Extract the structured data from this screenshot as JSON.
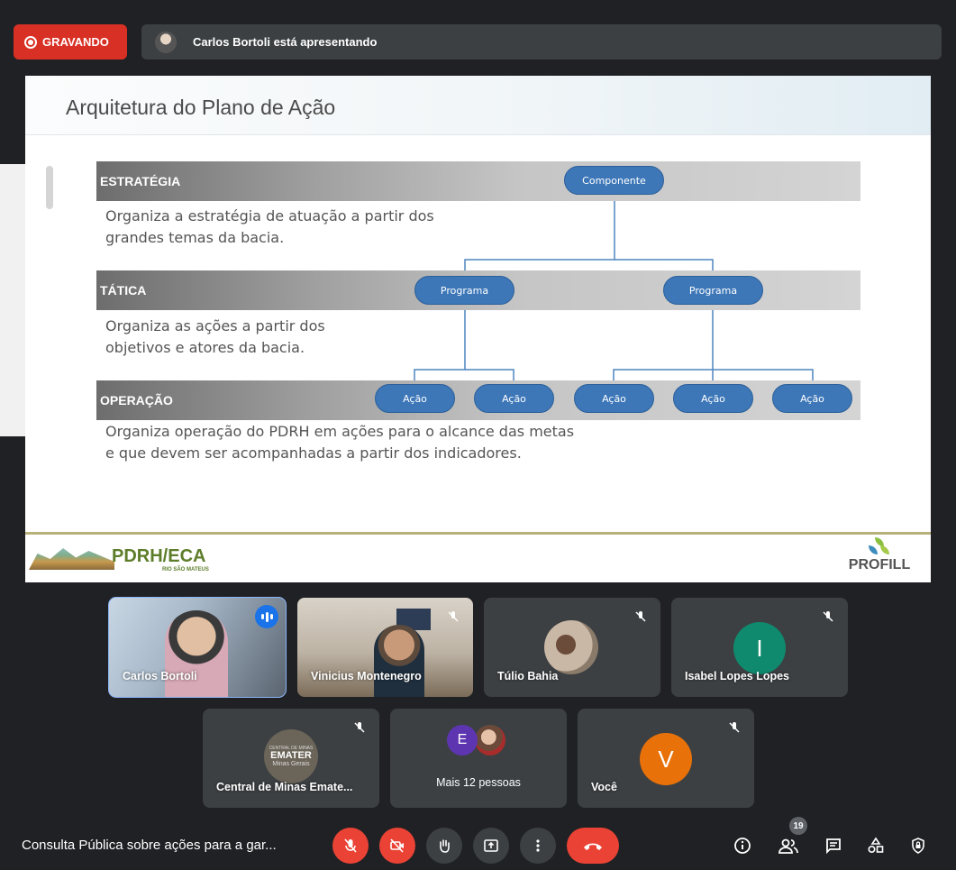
{
  "top": {
    "recording_label": "GRAVANDO",
    "presenting_label": "Carlos Bortoli está apresentando"
  },
  "slide": {
    "title": "Arquitetura do Plano de Ação",
    "bands": [
      {
        "label": "ESTRATÉGIA",
        "description": [
          "Organiza a estratégia de atuação a partir dos",
          "grandes temas da bacia."
        ]
      },
      {
        "label": "TÁTICA",
        "description": [
          "Organiza as ações a partir dos",
          "objetivos e atores da bacia."
        ]
      },
      {
        "label": "OPERAÇÃO",
        "description": [
          "Organiza operação do PDRH em ações para o alcance das metas",
          "e que devem ser acompanhadas a partir dos indicadores."
        ]
      }
    ],
    "nodes": {
      "component": "Componente",
      "programs": [
        "Programa",
        "Programa"
      ],
      "actions": [
        "Ação",
        "Ação",
        "Ação",
        "Ação",
        "Ação"
      ]
    },
    "footer": {
      "logo_left": "PDRH/ECA",
      "logo_left_sub": "RIO SÃO MATEUS",
      "logo_right": "PROFILL"
    }
  },
  "participants": [
    {
      "name": "Carlos Bortoli"
    },
    {
      "name": "Vinicius Montenegro"
    },
    {
      "name": "Túlio Bahia"
    },
    {
      "name": "Isabel Lopes Lopes",
      "initial": "I"
    },
    {
      "name": "Central de Minas Emate...",
      "logo_line1": "CENTRAL DE MINAS",
      "logo_line2": "EMATER",
      "logo_line3": "Minas Gerais"
    },
    {
      "name": "Mais 12 pessoas",
      "initial": "E"
    },
    {
      "name": "Você",
      "initial": "V"
    }
  ],
  "bottom": {
    "meeting_title": "Consulta Pública sobre ações para a gar...",
    "people_count": "19"
  },
  "colors": {
    "background": "#202124",
    "tile": "#3c4043",
    "recording": "#d93025",
    "end_call": "#ea4335",
    "node": "#3d77b8",
    "active_speaker": "#8ab4f8",
    "isabel_avatar": "#0f8a6e",
    "voce_avatar": "#e8710a",
    "e_avatar": "#5e35b1"
  },
  "icons": [
    "record-icon",
    "mic-off-icon",
    "camera-off-icon",
    "raise-hand-icon",
    "present-icon",
    "more-icon",
    "end-call-icon",
    "info-icon",
    "people-icon",
    "chat-icon",
    "activities-icon",
    "host-controls-icon"
  ]
}
